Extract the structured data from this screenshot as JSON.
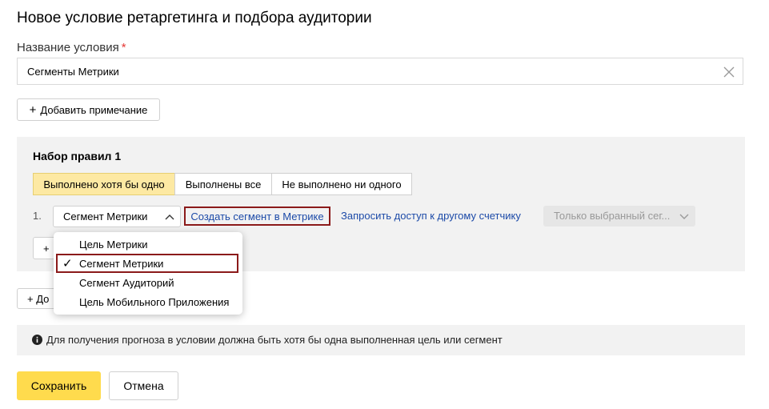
{
  "page": {
    "title": "Новое условие ретаргетинга и подбора аудитории"
  },
  "name_field": {
    "label": "Название условия",
    "required_mark": "*",
    "value": "Сегменты Метрики"
  },
  "add_note_label": "Добавить примечание",
  "ruleset": {
    "title": "Набор правил 1",
    "modes": [
      {
        "label": "Выполнено хотя бы одно",
        "active": true
      },
      {
        "label": "Выполнены все",
        "active": false
      },
      {
        "label": "Не выполнено ни одного",
        "active": false
      }
    ],
    "rule": {
      "number": "1.",
      "type_value": "Сегмент Метрики",
      "create_link": "Создать сегмент в Метрике",
      "access_link": "Запросить доступ к другому счетчику",
      "scope_value": "Только выбранный сег..."
    },
    "add_rule_partial": "+",
    "add_ruleset_partial": "+ До"
  },
  "dropdown": {
    "items": [
      {
        "label": "Цель Метрики",
        "selected": false
      },
      {
        "label": "Сегмент Метрики",
        "selected": true
      },
      {
        "label": "Сегмент Аудиторий",
        "selected": false
      },
      {
        "label": "Цель Мобильного Приложения",
        "selected": false
      }
    ],
    "check_glyph": "✓"
  },
  "info": {
    "text": "Для получения прогноза в условии должна быть хотя бы одна выполненная цель или сегмент"
  },
  "actions": {
    "save": "Сохранить",
    "cancel": "Отмена"
  },
  "colors": {
    "accent_yellow": "#ffdb4d",
    "active_mode": "#fde9a3",
    "link_blue": "#1c4aa8",
    "highlight_red": "#8b1a1a",
    "panel_gray": "#f2f2f2"
  }
}
